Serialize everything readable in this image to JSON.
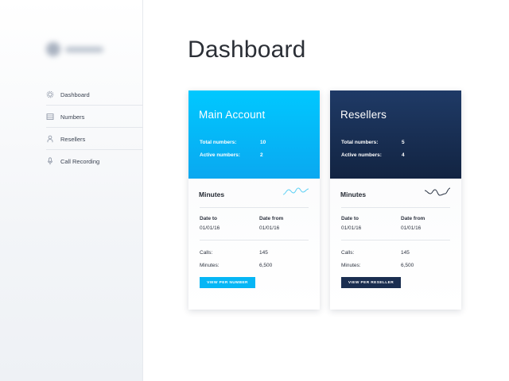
{
  "sidebar": {
    "items": [
      {
        "label": "Dashboard",
        "icon": "gear-icon"
      },
      {
        "label": "Numbers",
        "icon": "grid-icon"
      },
      {
        "label": "Resellers",
        "icon": "user-icon"
      },
      {
        "label": "Call Recording",
        "icon": "microphone-icon"
      }
    ]
  },
  "page": {
    "title": "Dashboard"
  },
  "cards": [
    {
      "title": "Main Account",
      "stats": [
        {
          "label": "Total numbers:",
          "value": "10"
        },
        {
          "label": "Active numbers:",
          "value": "2"
        }
      ],
      "section_title": "Minutes",
      "date_to_label": "Date to",
      "date_to_value": "01/01/16",
      "date_from_label": "Date from",
      "date_from_value": "01/01/16",
      "calls_label": "Calls:",
      "calls_value": "145",
      "minutes_label": "Minutes:",
      "minutes_value": "6,500",
      "button_label": "View per number",
      "accent": "#00c8ff"
    },
    {
      "title": "Resellers",
      "stats": [
        {
          "label": "Total numbers:",
          "value": "5"
        },
        {
          "label": "Active numbers:",
          "value": "4"
        }
      ],
      "section_title": "Minutes",
      "date_to_label": "Date to",
      "date_to_value": "01/01/16",
      "date_from_label": "Date from",
      "date_from_value": "01/01/16",
      "calls_label": "Calls:",
      "calls_value": "145",
      "minutes_label": "Minutes:",
      "minutes_value": "6,500",
      "button_label": "View per reseller",
      "accent": "#1a2e50"
    }
  ]
}
